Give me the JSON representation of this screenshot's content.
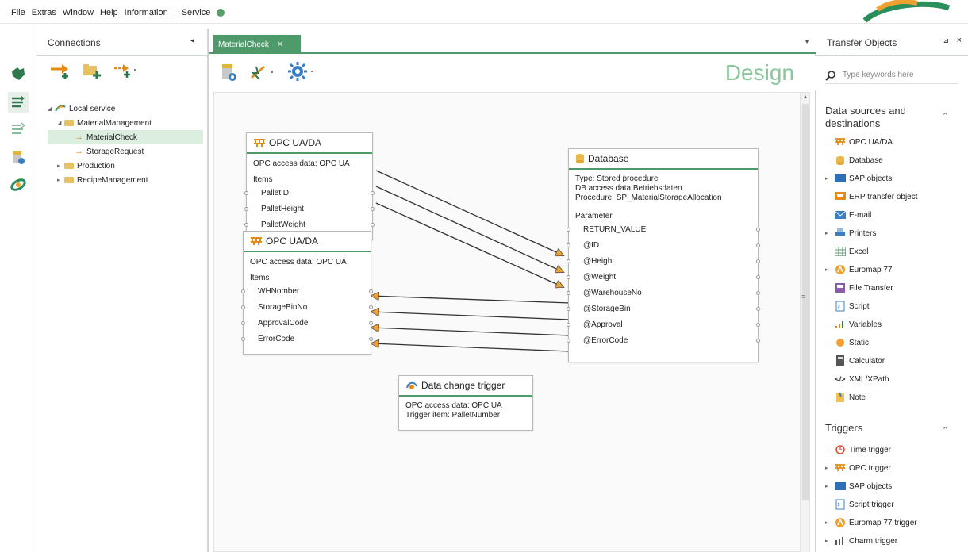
{
  "menu": {
    "items": [
      "File",
      "Extras",
      "Window",
      "Help",
      "Information"
    ],
    "service_label": "Service"
  },
  "connections": {
    "title": "Connections",
    "pin": "◂",
    "tree": [
      {
        "label": "Local service",
        "level": 0,
        "type": "root"
      },
      {
        "label": "MaterialManagement",
        "level": 1,
        "type": "folder"
      },
      {
        "label": "MaterialCheck",
        "level": 2,
        "type": "flow",
        "selected": true
      },
      {
        "label": "StorageRequest",
        "level": 2,
        "type": "flow"
      },
      {
        "label": "Production",
        "level": 1,
        "type": "folder"
      },
      {
        "label": "RecipeManagement",
        "level": 1,
        "type": "folder"
      }
    ]
  },
  "editor": {
    "tab_label": "MaterialCheck",
    "tab_close": "×",
    "mode_label": "Design"
  },
  "nodes": {
    "opc1": {
      "title": "OPC UA/DA",
      "access": "OPC access data: OPC UA",
      "items_label": "Items",
      "items": [
        "PalletID",
        "PalletHeight",
        "PalletWeight"
      ]
    },
    "opc2": {
      "title": "OPC UA/DA",
      "access": "OPC access data: OPC UA",
      "items_label": "Items",
      "items": [
        "WHNomber",
        "StorageBinNo",
        "ApprovalCode",
        "ErrorCode"
      ]
    },
    "db": {
      "title": "Database",
      "type": "Type: Stored procedure",
      "access": "DB access data:Betriebsdaten",
      "procedure": "Procedure: SP_MaterialStorageAllocation",
      "param_label": "Parameter",
      "params": [
        "RETURN_VALUE",
        "@ID",
        "@Height",
        "@Weight",
        "@WarehouseNo",
        "@StorageBin",
        "@Approval",
        "@ErrorCode"
      ]
    },
    "trigger": {
      "title": "Data change trigger",
      "access": "OPC access data: OPC UA",
      "item": "Trigger item: PalletNumber"
    }
  },
  "transfer": {
    "title": "Transfer Objects",
    "pin": "⊿",
    "close": "×",
    "search_placeholder": "Type keywords here",
    "section1_title": "Data sources and destinations",
    "sources": [
      {
        "label": "OPC UA/DA",
        "icon": "opc-icon",
        "expandable": false
      },
      {
        "label": "Database",
        "icon": "database-icon",
        "expandable": false
      },
      {
        "label": "SAP objects",
        "icon": "sap-icon",
        "expandable": true
      },
      {
        "label": "ERP transfer object",
        "icon": "erp-icon",
        "expandable": false
      },
      {
        "label": "E-mail",
        "icon": "email-icon",
        "expandable": false
      },
      {
        "label": "Printers",
        "icon": "printer-icon",
        "expandable": true
      },
      {
        "label": "Excel",
        "icon": "excel-icon",
        "expandable": false
      },
      {
        "label": "Euromap 77",
        "icon": "euromap-icon",
        "expandable": true
      },
      {
        "label": "File Transfer",
        "icon": "file-transfer-icon",
        "expandable": false
      },
      {
        "label": "Script",
        "icon": "script-icon",
        "expandable": false
      },
      {
        "label": "Variables",
        "icon": "variables-icon",
        "expandable": false
      },
      {
        "label": "Static",
        "icon": "static-icon",
        "expandable": false
      },
      {
        "label": "Calculator",
        "icon": "calculator-icon",
        "expandable": false
      },
      {
        "label": "XML/XPath",
        "icon": "xml-icon",
        "expandable": false
      },
      {
        "label": "Note",
        "icon": "note-icon",
        "expandable": false
      }
    ],
    "section2_title": "Triggers",
    "triggers": [
      {
        "label": "Time trigger",
        "icon": "clock-icon",
        "expandable": false
      },
      {
        "label": "OPC trigger",
        "icon": "opc-icon",
        "expandable": true
      },
      {
        "label": "SAP objects",
        "icon": "sap-icon",
        "expandable": true
      },
      {
        "label": "Script trigger",
        "icon": "script-icon",
        "expandable": false
      },
      {
        "label": "Euromap 77 trigger",
        "icon": "euromap-icon",
        "expandable": true
      },
      {
        "label": "Charm trigger",
        "icon": "charm-icon",
        "expandable": true
      }
    ]
  },
  "colors": {
    "accent": "#4e9a6b",
    "orange": "#e48a16",
    "design_text": "#8ac79d",
    "status_dot": "#5a9e6a"
  }
}
